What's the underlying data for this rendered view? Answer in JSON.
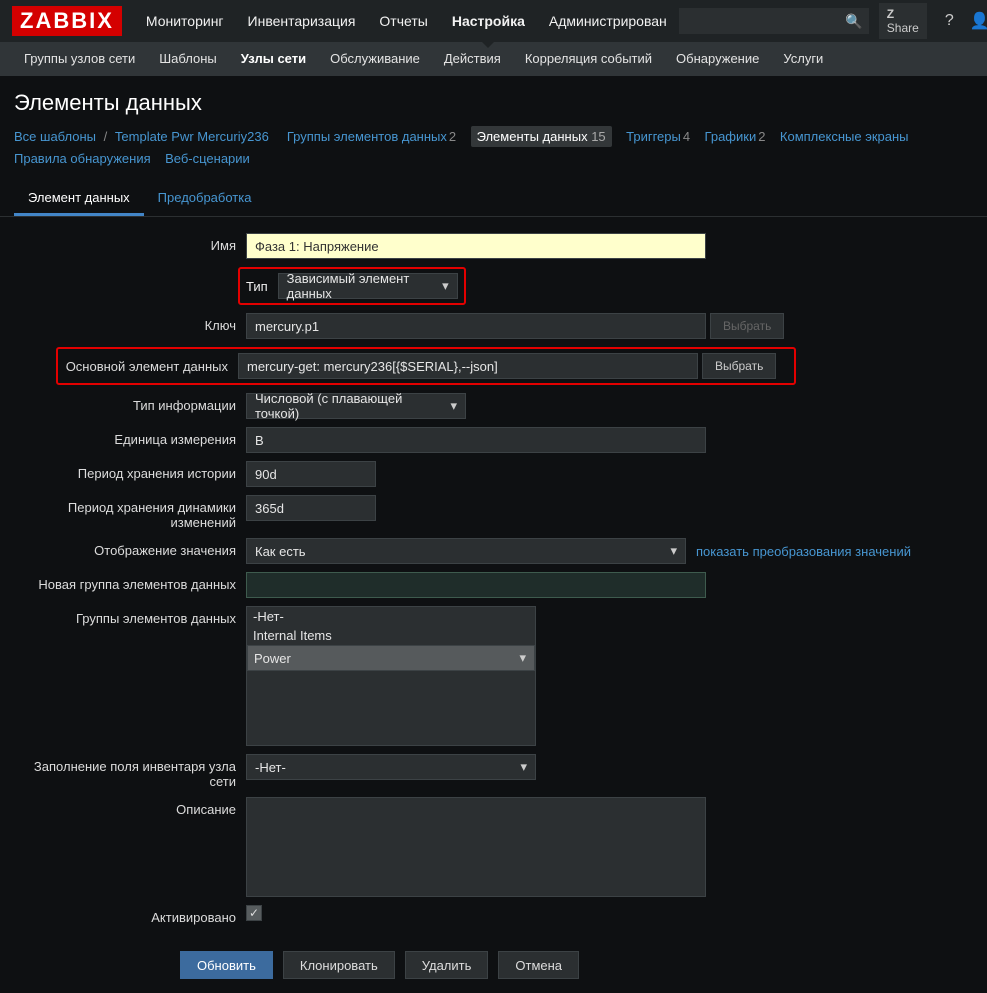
{
  "brand": "ZABBIX",
  "topnav": [
    "Мониторинг",
    "Инвентаризация",
    "Отчеты",
    "Настройка",
    "Администрирован"
  ],
  "topnav_active": 3,
  "share": "Share",
  "subnav": [
    "Группы узлов сети",
    "Шаблоны",
    "Узлы сети",
    "Обслуживание",
    "Действия",
    "Корреляция событий",
    "Обнаружение",
    "Услуги"
  ],
  "subnav_active": 2,
  "page_title": "Элементы данных",
  "bc": {
    "all_templates": "Все шаблоны",
    "template": "Template Pwr Mercuriy236",
    "groups": "Группы элементов данных",
    "groups_n": "2",
    "items": "Элементы данных",
    "items_n": "15",
    "triggers": "Триггеры",
    "triggers_n": "4",
    "graphs": "Графики",
    "graphs_n": "2",
    "screens": "Комплексные экраны",
    "discovery": "Правила обнаружения",
    "web": "Веб-сценарии"
  },
  "tabs": [
    "Элемент данных",
    "Предобработка"
  ],
  "labels": {
    "name": "Имя",
    "type": "Тип",
    "key": "Ключ",
    "master": "Основной элемент данных",
    "info": "Тип информации",
    "units": "Единица измерения",
    "history": "Период хранения истории",
    "trends": "Период хранения динамики изменений",
    "valuemap": "Отображение значения",
    "newgroup": "Новая группа элементов данных",
    "groups": "Группы элементов данных",
    "inventory": "Заполнение поля инвентаря узла сети",
    "description": "Описание",
    "enabled": "Активировано"
  },
  "values": {
    "name": "Фаза 1: Напряжение",
    "type": "Зависимый элемент данных",
    "key": "mercury.p1",
    "master": "mercury-get: mercury236[{$SERIAL},--json]",
    "info": "Числовой (с плавающей точкой)",
    "units": "В",
    "history": "90d",
    "trends": "365d",
    "valuemap": "Как есть",
    "inventory": "-Нет-"
  },
  "valuemap_link": "показать преобразования значений",
  "group_options": [
    "-Нет-",
    "Internal Items",
    "Power"
  ],
  "buttons": {
    "select": "Выбрать",
    "update": "Обновить",
    "clone": "Клонировать",
    "delete": "Удалить",
    "cancel": "Отмена"
  }
}
